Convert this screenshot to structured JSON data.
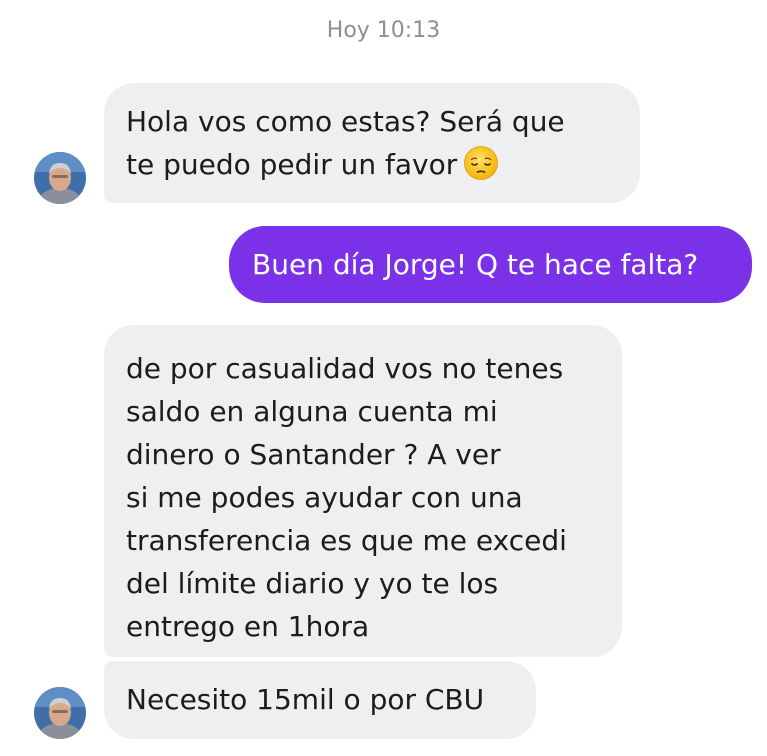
{
  "conversation": {
    "timestamp": "Hoy 10:13",
    "messages": [
      {
        "direction": "incoming",
        "text": "Hola  vos como estas? Será que\nte puedo pedir un favor",
        "emoji": "pensive-face-icon"
      },
      {
        "direction": "outgoing",
        "text": "Buen día Jorge! Q te hace falta?"
      },
      {
        "direction": "incoming",
        "text": "de por casualidad vos no tenes\nsaldo en alguna cuenta mi\ndinero  o Santander ? A ver\nsi me podes ayudar con una\ntransferencia es que me excedi\ndel límite diario y yo te los\nentrego en 1hora"
      },
      {
        "direction": "incoming",
        "text": "Necesito 15mil o por CBU"
      }
    ]
  },
  "colors": {
    "incoming_bubble": "#efeff2",
    "outgoing_bubble": "#7a31e8",
    "timestamp_text": "#8e8e93"
  }
}
